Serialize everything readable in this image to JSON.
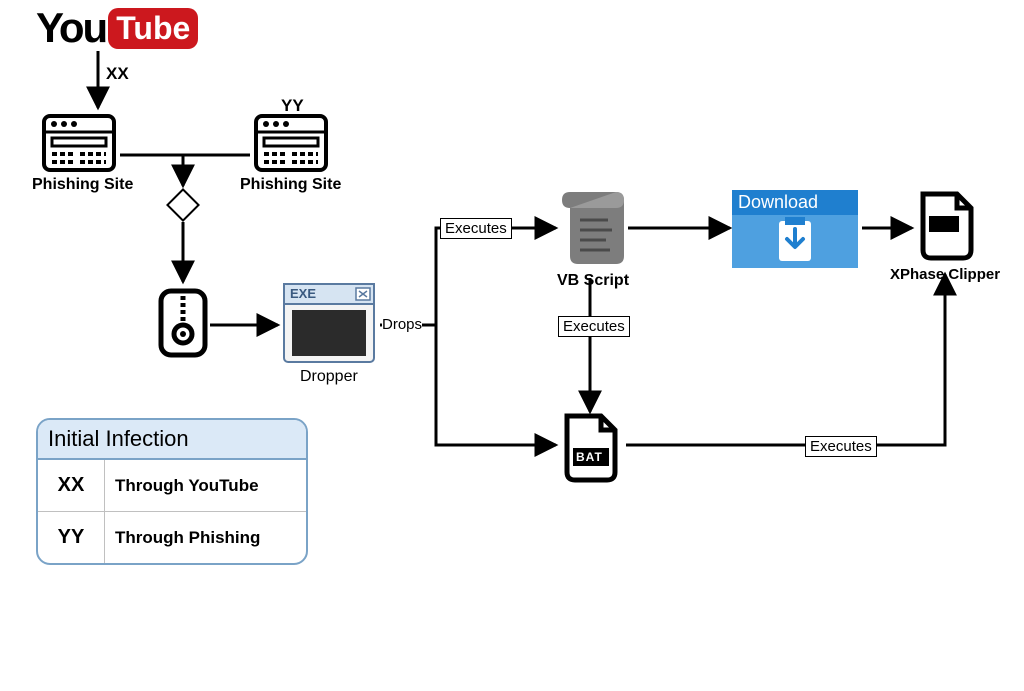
{
  "nodes": {
    "youtube": {
      "name": "YouTube"
    },
    "phishing_site_left": {
      "label": "Phishing Site"
    },
    "phishing_site_right": {
      "label": "Phishing Site"
    },
    "zip": {},
    "dropper": {
      "label": "Dropper",
      "badge": "EXE"
    },
    "vbscript": {
      "label": "VB Script"
    },
    "bat": {
      "label": "BAT"
    },
    "download": {
      "label": "Download"
    },
    "xphase": {
      "label": "XPhase Clipper"
    }
  },
  "edges": {
    "xx": "XX",
    "yy": "YY",
    "drops": "Drops",
    "executes1": "Executes",
    "executes2": "Executes",
    "executes3": "Executes"
  },
  "legend": {
    "title": "Initial Infection",
    "rows": [
      {
        "key": "XX",
        "value": "Through YouTube"
      },
      {
        "key": "YY",
        "value": "Through Phishing"
      }
    ]
  }
}
